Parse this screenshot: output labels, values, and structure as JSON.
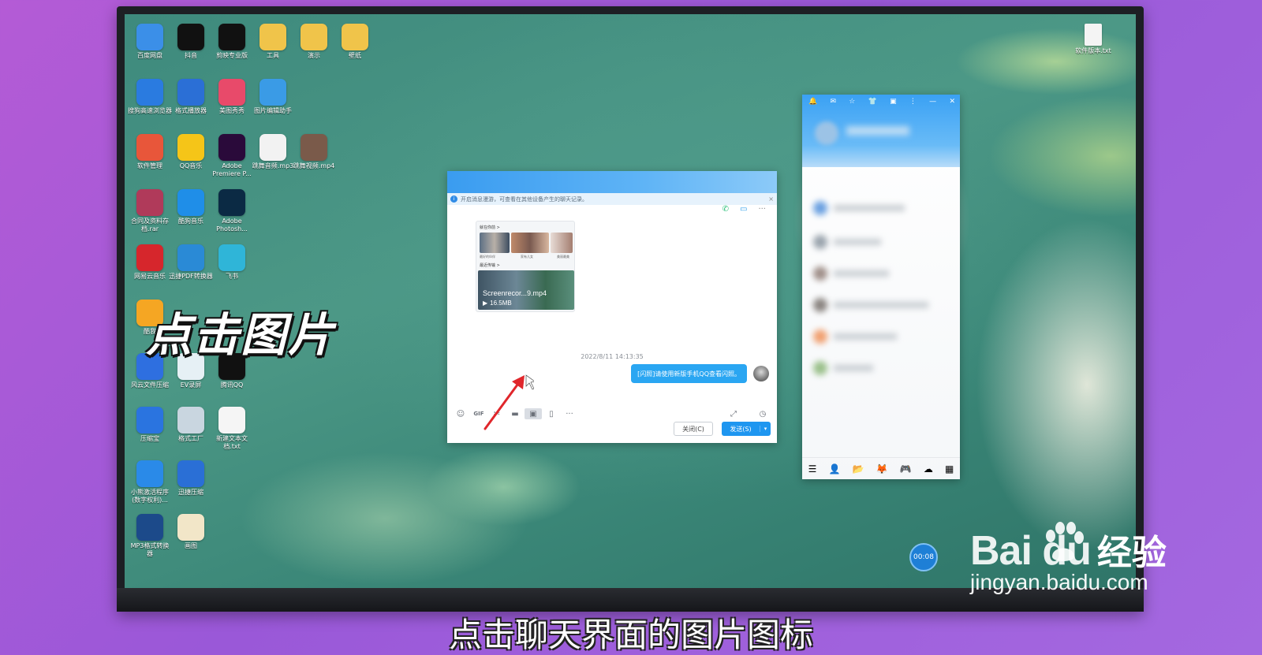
{
  "desktop_icons": [
    {
      "label": "百度网盘",
      "icon": "cloud-icon",
      "color": "#3b8fe8"
    },
    {
      "label": "抖音",
      "icon": "tiktok-icon",
      "color": "#111111"
    },
    {
      "label": "剪映专业版",
      "icon": "capcut-icon",
      "color": "#111111"
    },
    {
      "label": "工具",
      "icon": "folder-icon",
      "color": "#f0c44a"
    },
    {
      "label": "演示",
      "icon": "folder-icon",
      "color": "#f0c44a"
    },
    {
      "label": "壁纸",
      "icon": "folder-icon",
      "color": "#f0c44a"
    },
    {
      "label": "搜狗高速浏览器",
      "icon": "browser-icon",
      "color": "#2a7be0"
    },
    {
      "label": "格式播放器",
      "icon": "player-icon",
      "color": "#2b6fd6"
    },
    {
      "label": "美图秀秀",
      "icon": "meitu-icon",
      "color": "#e84a6a"
    },
    {
      "label": "图片编辑助手",
      "icon": "image-editor-icon",
      "color": "#3a9be6"
    },
    {
      "label": "软件管理",
      "icon": "app-manager-icon",
      "color": "#e8563a"
    },
    {
      "label": "QQ音乐",
      "icon": "music-icon",
      "color": "#f5c518"
    },
    {
      "label": "Adobe Premiere P...",
      "icon": "premiere-icon",
      "color": "#2a0a3a"
    },
    {
      "label": "跳舞音频.mp3",
      "icon": "audio-file-icon",
      "color": "#f2f2f2"
    },
    {
      "label": "跳舞视频.mp4",
      "icon": "video-file-icon",
      "color": "#7a5a4a"
    },
    {
      "label": "合同及资料存档.rar",
      "icon": "archive-icon",
      "color": "#b03a5a"
    },
    {
      "label": "酷狗音乐",
      "icon": "kugou-icon",
      "color": "#1f8ee8"
    },
    {
      "label": "Adobe Photosh...",
      "icon": "photoshop-icon",
      "color": "#0b2a44"
    },
    {
      "label": "网易云音乐",
      "icon": "netease-music-icon",
      "color": "#d6262c"
    },
    {
      "label": "迅捷PDF转换器",
      "icon": "pdf-converter-icon",
      "color": "#2a8ad6"
    },
    {
      "label": "飞书",
      "icon": "feishu-icon",
      "color": "#2fb5d8"
    },
    {
      "label": "酷我",
      "icon": "kuwo-icon",
      "color": "#f5a623"
    },
    {
      "label": "风云文件压缩",
      "icon": "compress-icon",
      "color": "#2e6fe0"
    },
    {
      "label": "EV录屏",
      "icon": "screen-recorder-icon",
      "color": "#e6f0f5"
    },
    {
      "label": "腾讯QQ",
      "icon": "qq-penguin-icon",
      "color": "#111111"
    },
    {
      "label": "压缩宝",
      "icon": "compress-bao-icon",
      "color": "#2a74e0"
    },
    {
      "label": "格式工厂",
      "icon": "format-factory-icon",
      "color": "#c9d6e0"
    },
    {
      "label": "新建文本文档.txt",
      "icon": "text-file-icon",
      "color": "#f5f5f5"
    },
    {
      "label": "小熊激活程序(数字权利)...",
      "icon": "windows-icon",
      "color": "#2a8ae8"
    },
    {
      "label": "迅捷压缩",
      "icon": "xunjie-compress-icon",
      "color": "#2a6fd6"
    },
    {
      "label": "MP3格式转换器",
      "icon": "mp3-converter-icon",
      "color": "#1c4a8a"
    },
    {
      "label": "画图",
      "icon": "paint-icon",
      "color": "#f2e6c8"
    }
  ],
  "desktop_icon_right": {
    "label": "软件版本.txt",
    "icon": "text-file-icon"
  },
  "chat": {
    "notice": "开启消息漫游，可查看在其他设备产生的聊天记录。",
    "card_header_1": "就在你前 >",
    "card_header_2": "最近传输 >",
    "thumb_caption_1": "最好的伙伴",
    "thumb_caption_2": "家有儿女",
    "thumb_caption_3": "美丽最美",
    "video_name": "Screenrecor...9.mp4",
    "video_size": "16.5MB",
    "timestamp": "2022/8/11 14:13:35",
    "message": "[闪照]请使用新版手机QQ查看闪照。",
    "toolbar": {
      "emoji": "☺",
      "gif": "GIF",
      "screenshot": "✂",
      "file": "▬",
      "image": "▣",
      "shake": "▯",
      "more": "···",
      "expand": "⤢",
      "history": "◷"
    },
    "close_label": "关闭(C)",
    "send_label": "发送(S)",
    "send_dropdown": "▾"
  },
  "qq_panel": {
    "header_icons": [
      "🔔",
      "✉",
      "☆",
      "👕",
      "▣",
      "⋮",
      "—",
      "✕"
    ],
    "footer_icons": [
      "☰",
      "👤",
      "📂",
      "🦊",
      "🎮",
      "☁",
      "▦"
    ]
  },
  "overlay": {
    "big_caption": "点击图片",
    "subtitle": "点击聊天界面的图片图标",
    "timer": "00:08",
    "watermark_brand": "Bai du",
    "watermark_cn": "经验",
    "watermark_url": "jingyan.baidu.com"
  },
  "colors": {
    "qq_blue": "#1e96f0",
    "bubble_blue": "#2aa6f2",
    "arrow_red": "#e0262b"
  }
}
